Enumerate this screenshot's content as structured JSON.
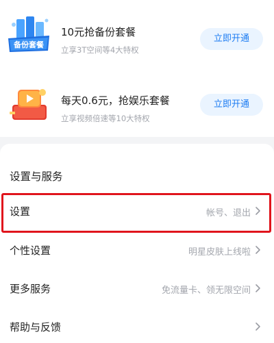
{
  "promos": [
    {
      "icon": "backup-package-icon",
      "title": "10元抢备份套餐",
      "subtitle": "立享3T空间等4大特权",
      "button_label": "立即开通",
      "icon_text": "备份套餐"
    },
    {
      "icon": "video-entertainment-icon",
      "title": "每天0.6元，抢娱乐套餐",
      "subtitle": "立享视频倍速等10大特权",
      "button_label": "立即开通"
    }
  ],
  "settings": {
    "section_title": "设置与服务",
    "items": [
      {
        "label": "设置",
        "value": "帐号、退出",
        "highlighted": true
      },
      {
        "label": "个性设置",
        "value": "明星皮肤上线啦"
      },
      {
        "label": "更多服务",
        "value": "免流量卡、领无限空间"
      },
      {
        "label": "帮助与反馈",
        "value": ""
      }
    ]
  },
  "colors": {
    "accent_blue": "#1d7cf2",
    "button_bg": "#eaf4ff",
    "highlight_red": "#e0141c",
    "page_bg": "#f3f4f6"
  }
}
